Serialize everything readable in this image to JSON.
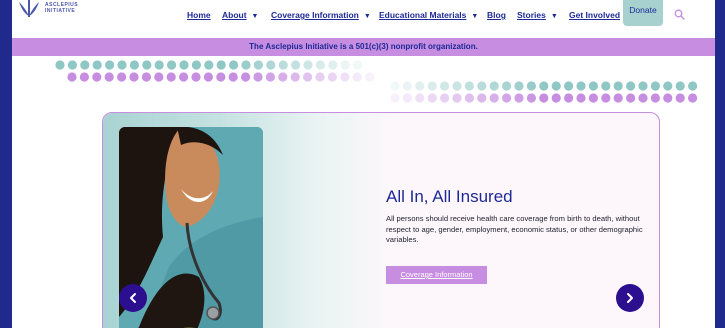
{
  "header": {
    "logo_text_line1": "ASCLEPIUS",
    "logo_text_line2": "INITIATIVE",
    "nav": [
      {
        "label": "Home",
        "has_menu": false
      },
      {
        "label": "About",
        "has_menu": true
      },
      {
        "label": "Coverage Information",
        "has_menu": true
      },
      {
        "label": "Educational Materials",
        "has_menu": true
      },
      {
        "label": "Blog",
        "has_menu": false
      },
      {
        "label": "Stories",
        "has_menu": true
      },
      {
        "label": "Get Involved",
        "has_menu": false
      }
    ],
    "donate_label": "Donate",
    "search_icon": "search-icon"
  },
  "banner": {
    "text": "The Asclepius Initiative is a 501(c)(3) nonprofit organization."
  },
  "hero": {
    "title": "All In, All Insured",
    "body": "All persons should receive health care coverage from birth to death, without respect to age, gender, employment, economic status, or other demographic variables.",
    "cta_label": "Coverage Information",
    "prev_icon": "chevron-left-icon",
    "next_icon": "chevron-right-icon"
  },
  "colors": {
    "frame": "#1f2a8c",
    "nav_text": "#1d2a96",
    "banner_bg": "#c68de0",
    "donate_bg": "#a7d1cf",
    "teal_dot": "#8fc7c4",
    "purple_dot": "#c68de0",
    "arrow_bg": "#2b0f8f"
  }
}
